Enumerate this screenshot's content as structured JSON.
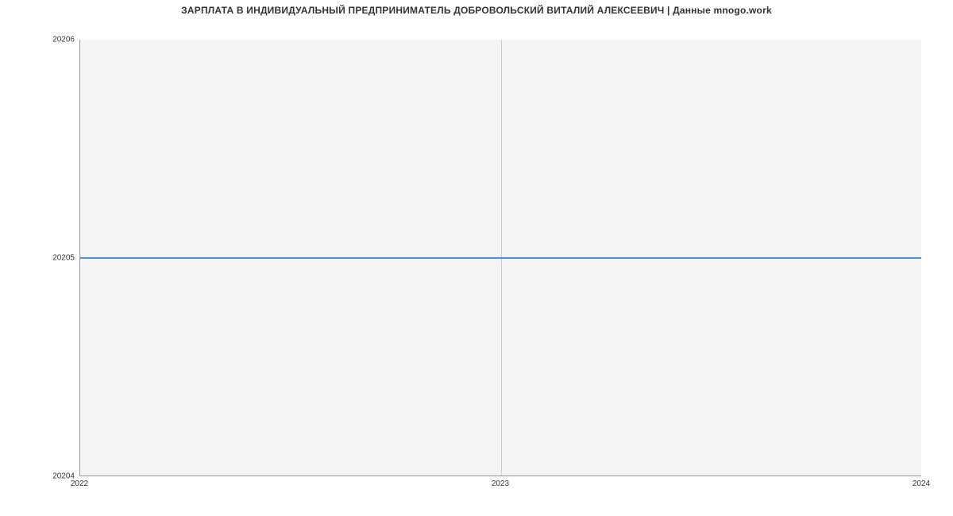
{
  "chart_data": {
    "type": "line",
    "title": "ЗАРПЛАТА В ИНДИВИДУАЛЬНЫЙ ПРЕДПРИНИМАТЕЛЬ ДОБРОВОЛЬСКИЙ ВИТАЛИЙ АЛЕКСЕЕВИЧ | Данные mnogo.work",
    "x": [
      2022,
      2024
    ],
    "y": [
      20205,
      20205
    ],
    "x_ticks": [
      2022,
      2023,
      2024
    ],
    "y_ticks": [
      20204,
      20205,
      20206
    ],
    "xlim": [
      2022,
      2024
    ],
    "ylim": [
      20204,
      20206
    ],
    "xlabel": "",
    "ylabel": "",
    "line_color": "#4a90e2",
    "grid": true
  }
}
